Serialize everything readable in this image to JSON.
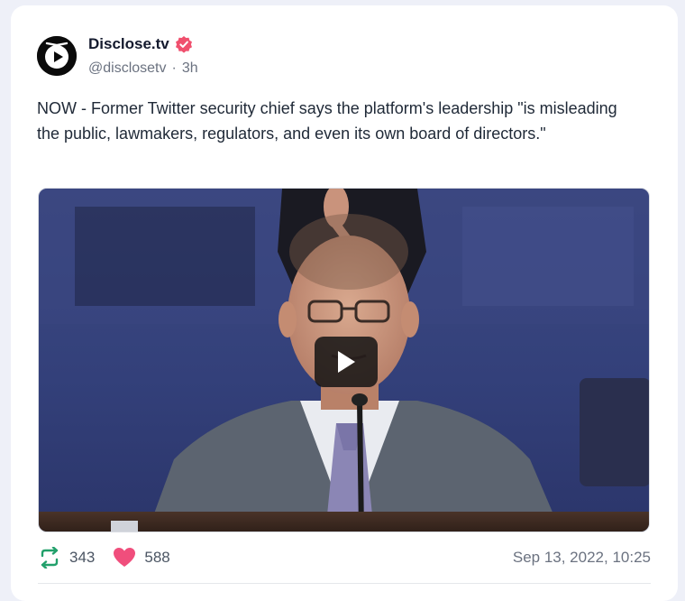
{
  "author": {
    "display_name": "Disclose.tv",
    "handle": "@disclosetv",
    "separator": "·",
    "time_ago": "3h",
    "verified_color": "#f0506e"
  },
  "tweet": {
    "text": "NOW - Former Twitter security chief says the platform's leadership \"is misleading the public, lawmakers, regulators, and even its own board of directors.\""
  },
  "media": {
    "type": "video",
    "play_icon": "play-icon"
  },
  "stats": {
    "retweets": "343",
    "likes": "588",
    "retweet_color": "#22a06b",
    "like_color": "#f04e7c"
  },
  "timestamp": "Sep 13, 2022, 10:25"
}
